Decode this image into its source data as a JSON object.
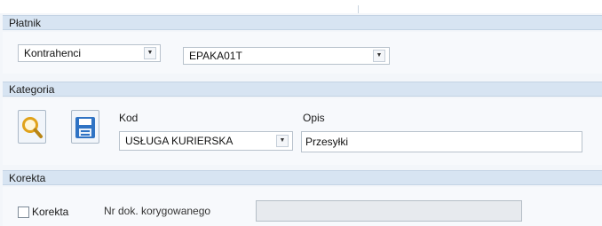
{
  "platnik": {
    "header": "Płatnik",
    "type_select": "Kontrahenci",
    "code_select": "EPAKA01T"
  },
  "kategoria": {
    "header": "Kategoria",
    "kod_label": "Kod",
    "kod_value": "USŁUGA KURIERSKA",
    "opis_label": "Opis",
    "opis_value": "Przesyłki"
  },
  "korekta": {
    "header": "Korekta",
    "checkbox_label": "Korekta",
    "nr_label": "Nr dok. korygowanego",
    "nr_value": ""
  },
  "icons": {
    "search": "magnifier-icon",
    "save": "floppy-disk-icon",
    "dropdown": "chevron-down-icon"
  },
  "colors": {
    "header_bg": "#d7e4f2",
    "panel_bg": "#f7f9fc",
    "icon_blue": "#2f73c4",
    "magnifier": "#e0a21a"
  }
}
